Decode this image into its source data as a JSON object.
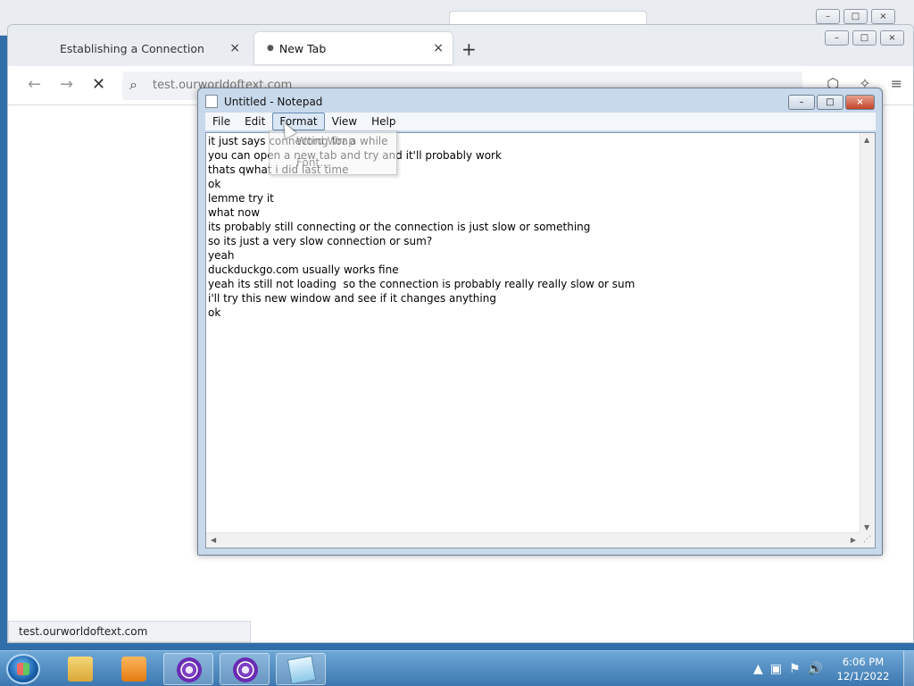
{
  "browser": {
    "tabs": [
      {
        "label": "Establishing a Connection",
        "close": "×"
      },
      {
        "label": "New Tab",
        "close": "×"
      }
    ],
    "new_tab_glyph": "+",
    "url": "test.ourworldoftext.com",
    "status_url": "test.ourworldoftext.com",
    "window_controls": {
      "minimize": "–",
      "maximize": "□",
      "close": "×"
    }
  },
  "notepad": {
    "title": "Untitled - Notepad",
    "menu": [
      "File",
      "Edit",
      "Format",
      "View",
      "Help"
    ],
    "open_menu": "Format",
    "format_menu_items": [
      "Word Wrap",
      "Font..."
    ],
    "window_controls": {
      "minimize": "–",
      "maximize": "□",
      "close": "×"
    },
    "lines": [
      "it just says connecting for a while",
      "you can open a new tab and try and it'll probably work",
      "thats qwhat i did last time",
      "ok",
      "lemme try it",
      "what now",
      "its probably still connecting or the connection is just slow or something",
      "so its just a very slow connection or sum?",
      "yeah",
      "duckduckgo.com usually works fine",
      "yeah its still not loading  so the connection is probably really really slow or sum",
      "i'll try this new window and see if it changes anything",
      "ok"
    ]
  },
  "taskbar": {
    "time": "6:06 PM",
    "date": "12/1/2022",
    "apps": [
      "windows-explorer",
      "media-player",
      "tor-browser",
      "tor-browser",
      "notepad"
    ]
  }
}
